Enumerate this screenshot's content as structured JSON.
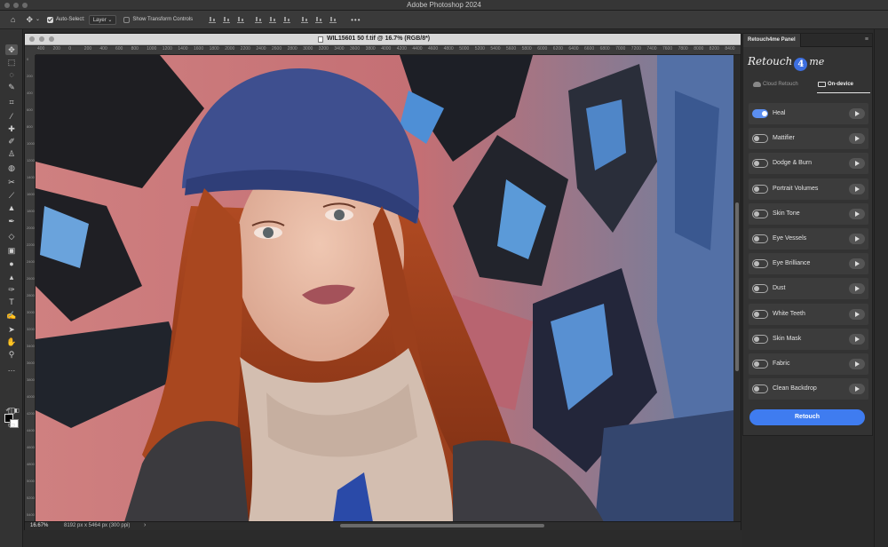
{
  "app": {
    "title": "Adobe Photoshop 2024"
  },
  "options_bar": {
    "auto_select_label": "Auto-Select:",
    "auto_select_target": "Layer",
    "transform_controls_label": "Show Transform Controls",
    "more_label": "•••"
  },
  "document": {
    "title": "WIL15601 50 f.tif @ 16.7% (RGB/8*)",
    "zoom": "16.67%",
    "dimensions": "8192 px x 5464 px (300 ppi)"
  },
  "ruler": {
    "top": [
      "400",
      "200",
      "0",
      "200",
      "400",
      "600",
      "800",
      "1000",
      "1200",
      "1400",
      "1600",
      "1800",
      "2000",
      "2200",
      "2400",
      "2600",
      "2800",
      "3000",
      "3200",
      "3400",
      "3600",
      "3800",
      "4000",
      "4200",
      "4400",
      "4600",
      "4800",
      "5000",
      "5200",
      "5400",
      "5600",
      "5800",
      "6000",
      "6200",
      "6400",
      "6600",
      "6800",
      "7000",
      "7200",
      "7400",
      "7600",
      "7800",
      "8000",
      "8200",
      "8400",
      "8600"
    ],
    "left": [
      "0",
      "200",
      "400",
      "600",
      "800",
      "1000",
      "1200",
      "1400",
      "1600",
      "1800",
      "2000",
      "2200",
      "2400",
      "2600",
      "2800",
      "3000",
      "3200",
      "3400",
      "3600",
      "3800",
      "4000",
      "4200",
      "4400",
      "4600",
      "4800",
      "5000",
      "5200",
      "5400"
    ]
  },
  "panel": {
    "tab_label": "Retouch4me Panel",
    "brand_left": "Retouch",
    "brand_mid": "4",
    "brand_right": "me",
    "mode_cloud": "Cloud Retouch",
    "mode_device": "On-device",
    "items": [
      {
        "label": "Heal",
        "enabled": true
      },
      {
        "label": "Mattifier",
        "enabled": false
      },
      {
        "label": "Dodge & Burn",
        "enabled": false
      },
      {
        "label": "Portrait Volumes",
        "enabled": false
      },
      {
        "label": "Skin Tone",
        "enabled": false
      },
      {
        "label": "Eye Vessels",
        "enabled": false
      },
      {
        "label": "Eye Brilliance",
        "enabled": false
      },
      {
        "label": "Dust",
        "enabled": false
      },
      {
        "label": "White Teeth",
        "enabled": false
      },
      {
        "label": "Skin Mask",
        "enabled": false
      },
      {
        "label": "Fabric",
        "enabled": false
      },
      {
        "label": "Clean Backdrop",
        "enabled": false
      }
    ],
    "retouch_button": "Retouch",
    "accent": "#3f7cf0"
  }
}
